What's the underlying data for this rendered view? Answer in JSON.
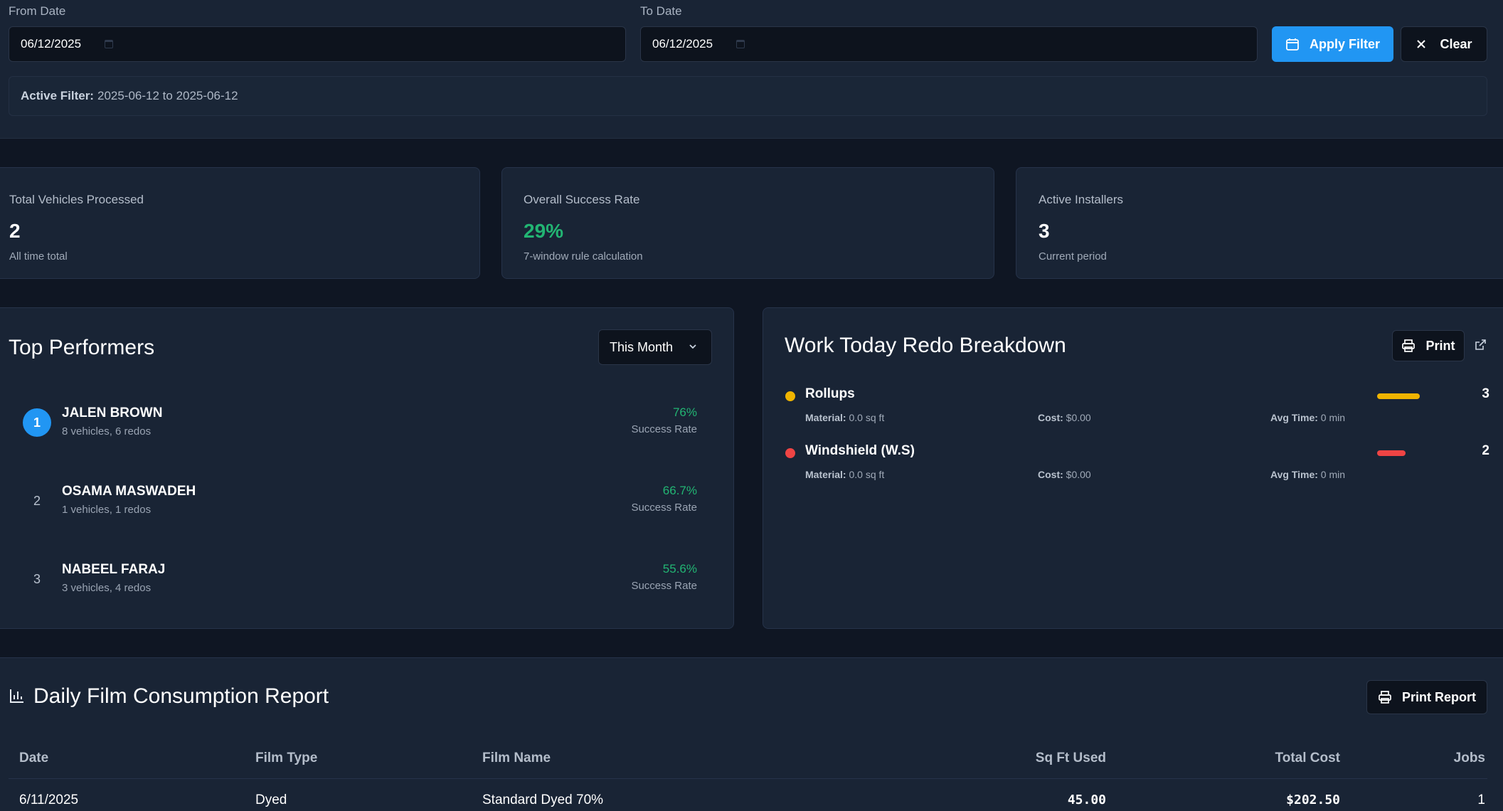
{
  "filter": {
    "from_label": "From Date",
    "from_value": "06/12/2025",
    "to_label": "To Date",
    "to_value": "06/12/2025",
    "apply_label": "Apply Filter",
    "clear_label": "Clear",
    "active_prefix": "Active Filter:",
    "active_value": "2025-06-12 to 2025-06-12"
  },
  "stats": [
    {
      "title": "Total Vehicles Processed",
      "value": "2",
      "sub": "All time total"
    },
    {
      "title": "Overall Success Rate",
      "value": "29%",
      "sub": "7-window rule calculation",
      "color": "#22b573"
    },
    {
      "title": "Active Installers",
      "value": "3",
      "sub": "Current period"
    }
  ],
  "performers": {
    "title": "Top Performers",
    "period": "This Month",
    "items": [
      {
        "rank": "1",
        "name": "JALEN BROWN",
        "meta": "8 vehicles, 6 redos",
        "rate": "76%",
        "rate_label": "Success Rate"
      },
      {
        "rank": "2",
        "name": "OSAMA MASWADEH",
        "meta": "1 vehicles, 1 redos",
        "rate": "66.7%",
        "rate_label": "Success Rate"
      },
      {
        "rank": "3",
        "name": "NABEEL FARAJ",
        "meta": "3 vehicles, 4 redos",
        "rate": "55.6%",
        "rate_label": "Success Rate"
      }
    ]
  },
  "redo": {
    "title": "Work Today Redo Breakdown",
    "print_label": "Print",
    "items": [
      {
        "name": "Rollups",
        "color": "#f0b400",
        "material_label": "Material:",
        "material": "0.0 sq ft",
        "cost_label": "Cost:",
        "cost": "$0.00",
        "time_label": "Avg Time:",
        "time": "0 min",
        "count": "3",
        "share": 1.0
      },
      {
        "name": "Windshield (W.S)",
        "color": "#ef4444",
        "material_label": "Material:",
        "material": "0.0 sq ft",
        "cost_label": "Cost:",
        "cost": "$0.00",
        "time_label": "Avg Time:",
        "time": "0 min",
        "count": "2",
        "share": 0.67
      }
    ]
  },
  "film_report": {
    "title": "Daily Film Consumption Report",
    "print_label": "Print Report",
    "columns": [
      "Date",
      "Film Type",
      "Film Name",
      "Sq Ft Used",
      "Total Cost",
      "Jobs"
    ],
    "rows": [
      {
        "date": "6/11/2025",
        "film_type": "Dyed",
        "film_name": "Standard Dyed 70%",
        "sqft": "45.00",
        "cost": "$202.50",
        "jobs": "1"
      }
    ]
  }
}
